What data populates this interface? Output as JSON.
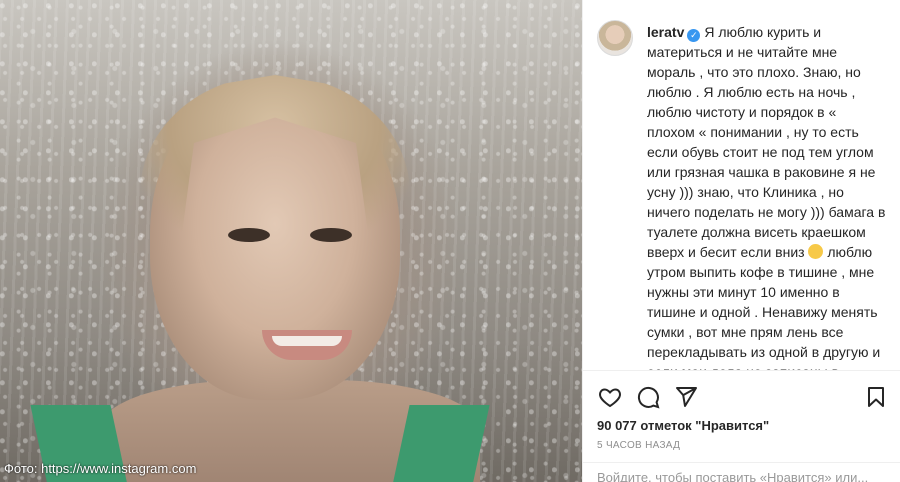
{
  "photo": {
    "credit": "Фото: https://www.instagram.com"
  },
  "post": {
    "username": "leratv",
    "caption": "Я люблю курить и материться и не читайте мне мораль , что это плохо. Знаю, но люблю . Я люблю есть на ночь , люблю чистоту и порядок в « плохом « понимании , ну то есть если обувь стоит не под тем углом или грязная чашка в раковине я не усну ))) знаю, что Клиника , но ничего поделать не могу ))) бамага в туалете должна висеть краешком вверх и бесит если вниз",
    "caption_after_emoji": " люблю утром выпить кофе в тишине , мне нужны эти минут 10 именно в тишине и одной . Ненавижу менять сумки , вот мне прям лень все перекладывать из одной в другую и если мои дела не записаны в бумажный ежедневник ( забыла записать например ), значит этих дел у меня нет :))) а у вас какие",
    "likes": "90 077 отметок \"Нравится\"",
    "time": "5 ЧАСОВ НАЗАД"
  },
  "comment": {
    "placeholder": "Войдите, чтобы поставить «Нравится» или..."
  },
  "icons": {
    "verified": "verified-badge-icon",
    "like": "heart-icon",
    "comment": "comment-icon",
    "share": "share-icon",
    "save": "bookmark-icon",
    "emoji": "smile-emoji-icon"
  },
  "colors": {
    "verified": "#3897f0",
    "text": "#262626",
    "muted": "#8e8e8e"
  }
}
